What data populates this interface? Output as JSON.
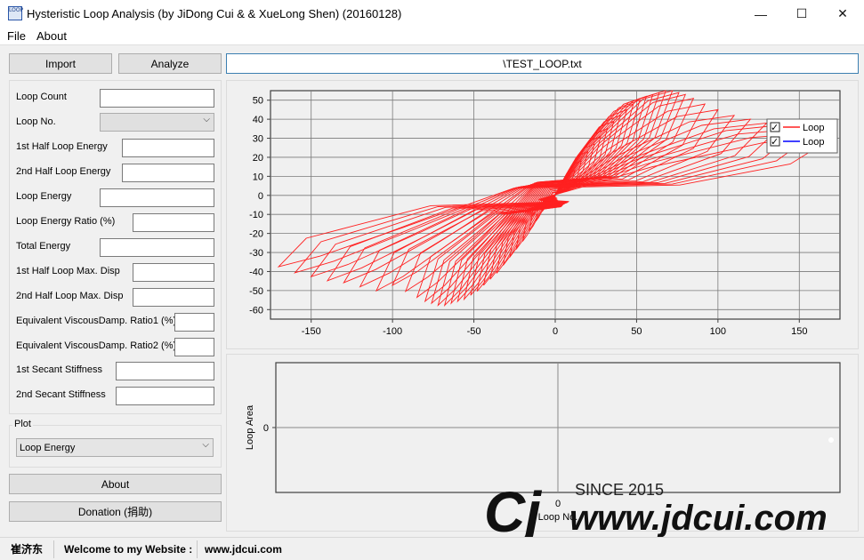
{
  "window": {
    "title": "Hysteristic Loop Analysis (by JiDong Cui & & XueLong Shen) (20160128)",
    "icon_label": "LOOP",
    "minimize_glyph": "—",
    "maximize_glyph": "☐",
    "close_glyph": "✕"
  },
  "menu": {
    "file": "File",
    "about": "About"
  },
  "toolbar": {
    "import_label": "Import",
    "analyze_label": "Analyze",
    "file_path": "\\TEST_LOOP.txt"
  },
  "fields": [
    {
      "label": "Loop Count",
      "value": ""
    },
    {
      "label": "Loop No.",
      "value": ""
    },
    {
      "label": "1st Half Loop Energy",
      "value": ""
    },
    {
      "label": "2nd Half Loop Energy",
      "value": ""
    },
    {
      "label": "Loop Energy",
      "value": ""
    },
    {
      "label": "Loop Energy Ratio (%)",
      "value": ""
    },
    {
      "label": "Total Energy",
      "value": ""
    },
    {
      "label": "1st Half Loop Max. Disp",
      "value": ""
    },
    {
      "label": "2nd Half Loop Max. Disp",
      "value": ""
    },
    {
      "label": "Equivalent ViscousDamp. Ratio1 (%)",
      "value": ""
    },
    {
      "label": "Equivalent ViscousDamp. Ratio2 (%)",
      "value": ""
    },
    {
      "label": "1st Secant Stiffness",
      "value": ""
    },
    {
      "label": "2nd Secant Stiffness",
      "value": ""
    }
  ],
  "plot": {
    "group_title": "Plot",
    "selected": "Loop Energy"
  },
  "buttons": {
    "about_label": "About",
    "donation_label": "Donation (捐助)"
  },
  "statusbar": {
    "author": "崔济东",
    "welcome": "Welcome to my Website :",
    "website": "www.jdcui.com"
  },
  "watermark": {
    "since": "SINCE 2015",
    "url": "www.jdcui.com",
    "logo": "Cj"
  },
  "chart_data": [
    {
      "type": "line",
      "title": "",
      "xlim": [
        -175,
        175
      ],
      "ylim": [
        -65,
        55
      ],
      "xticks": [
        -150,
        -100,
        -50,
        0,
        50,
        100,
        150
      ],
      "yticks": [
        50,
        40,
        30,
        20,
        10,
        0,
        -10,
        -20,
        -30,
        -40,
        -50,
        -60
      ],
      "grid": true,
      "legend_position": "top-right",
      "series": [
        {
          "name": "Loop",
          "color": "#ff2020",
          "checked": true
        },
        {
          "name": "Loop",
          "color": "#0000ff",
          "checked": true
        }
      ],
      "loop_amplitudes": [
        {
          "disp": 8,
          "force": 8
        },
        {
          "disp": 12,
          "force": 13
        },
        {
          "disp": 16,
          "force": 18
        },
        {
          "disp": 20,
          "force": 23
        },
        {
          "disp": 24,
          "force": 27
        },
        {
          "disp": 28,
          "force": 31
        },
        {
          "disp": 32,
          "force": 35
        },
        {
          "disp": 36,
          "force": 39
        },
        {
          "disp": 40,
          "force": 42
        },
        {
          "disp": 44,
          "force": 45
        },
        {
          "disp": 48,
          "force": 48
        },
        {
          "disp": 52,
          "force": 50
        },
        {
          "disp": 56,
          "force": 52
        },
        {
          "disp": 60,
          "force": 53
        },
        {
          "disp": 64,
          "force": 54
        },
        {
          "disp": 68,
          "force": 55
        },
        {
          "disp": 72,
          "force": 55
        },
        {
          "disp": 76,
          "force": 54
        },
        {
          "disp": 80,
          "force": 53
        },
        {
          "disp": 85,
          "force": 51
        },
        {
          "disp": 92,
          "force": 48
        },
        {
          "disp": 100,
          "force": 45
        },
        {
          "disp": 110,
          "force": 42
        },
        {
          "disp": 120,
          "force": 40
        },
        {
          "disp": 130,
          "force": 38
        },
        {
          "disp": 140,
          "force": 37
        },
        {
          "disp": 150,
          "force": 35
        },
        {
          "disp": 160,
          "force": 33
        },
        {
          "disp": 170,
          "force": 30
        }
      ]
    },
    {
      "type": "line",
      "title": "",
      "ylabel": "Loop Area",
      "xlabel": "Loop No.",
      "yticks": [
        0
      ],
      "xticks": [
        0
      ],
      "grid": true,
      "series": []
    }
  ]
}
